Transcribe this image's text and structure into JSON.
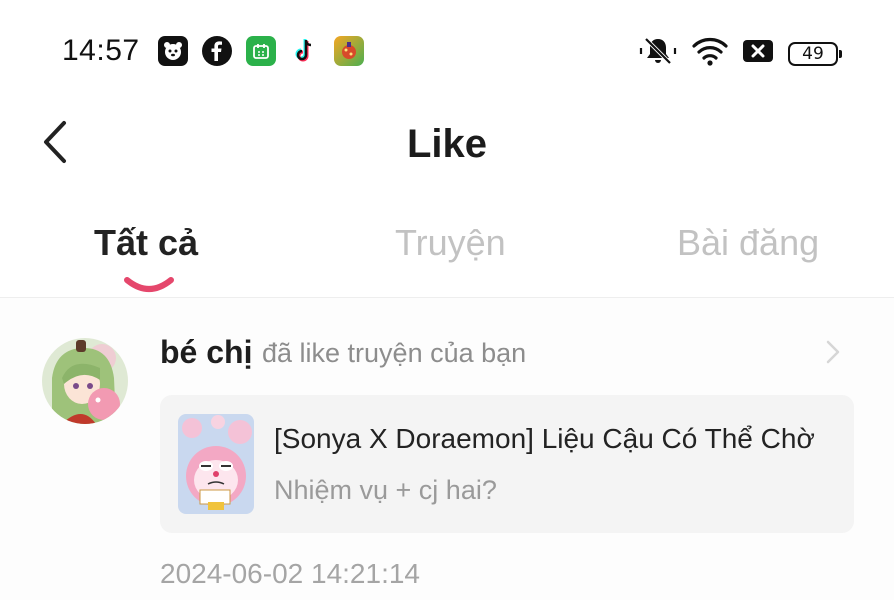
{
  "status_bar": {
    "time": "14:57",
    "app_icons": [
      "bear-app-icon",
      "facebook-icon",
      "wechat-icon",
      "tiktok-icon",
      "game-app-icon"
    ],
    "battery": "49"
  },
  "header": {
    "title": "Like",
    "back_icon": "chevron-left-icon"
  },
  "tabs": [
    {
      "label": "Tất cả",
      "active": true
    },
    {
      "label": "Truyện",
      "active": false
    },
    {
      "label": "Bài đăng",
      "active": false
    }
  ],
  "notification": {
    "username": "bé chị",
    "action": "đã like truyện của bạn",
    "story_title": "[Sonya X Doraemon] Liệu Cậu Có Thể Chờ",
    "story_subtitle": "Nhiệm vụ + cj hai?",
    "timestamp": "2024-06-02 14:21:14"
  },
  "colors": {
    "accent": "#e5476c",
    "inactive_tab": "#c2c2c2",
    "card_bg": "#f4f4f4"
  }
}
